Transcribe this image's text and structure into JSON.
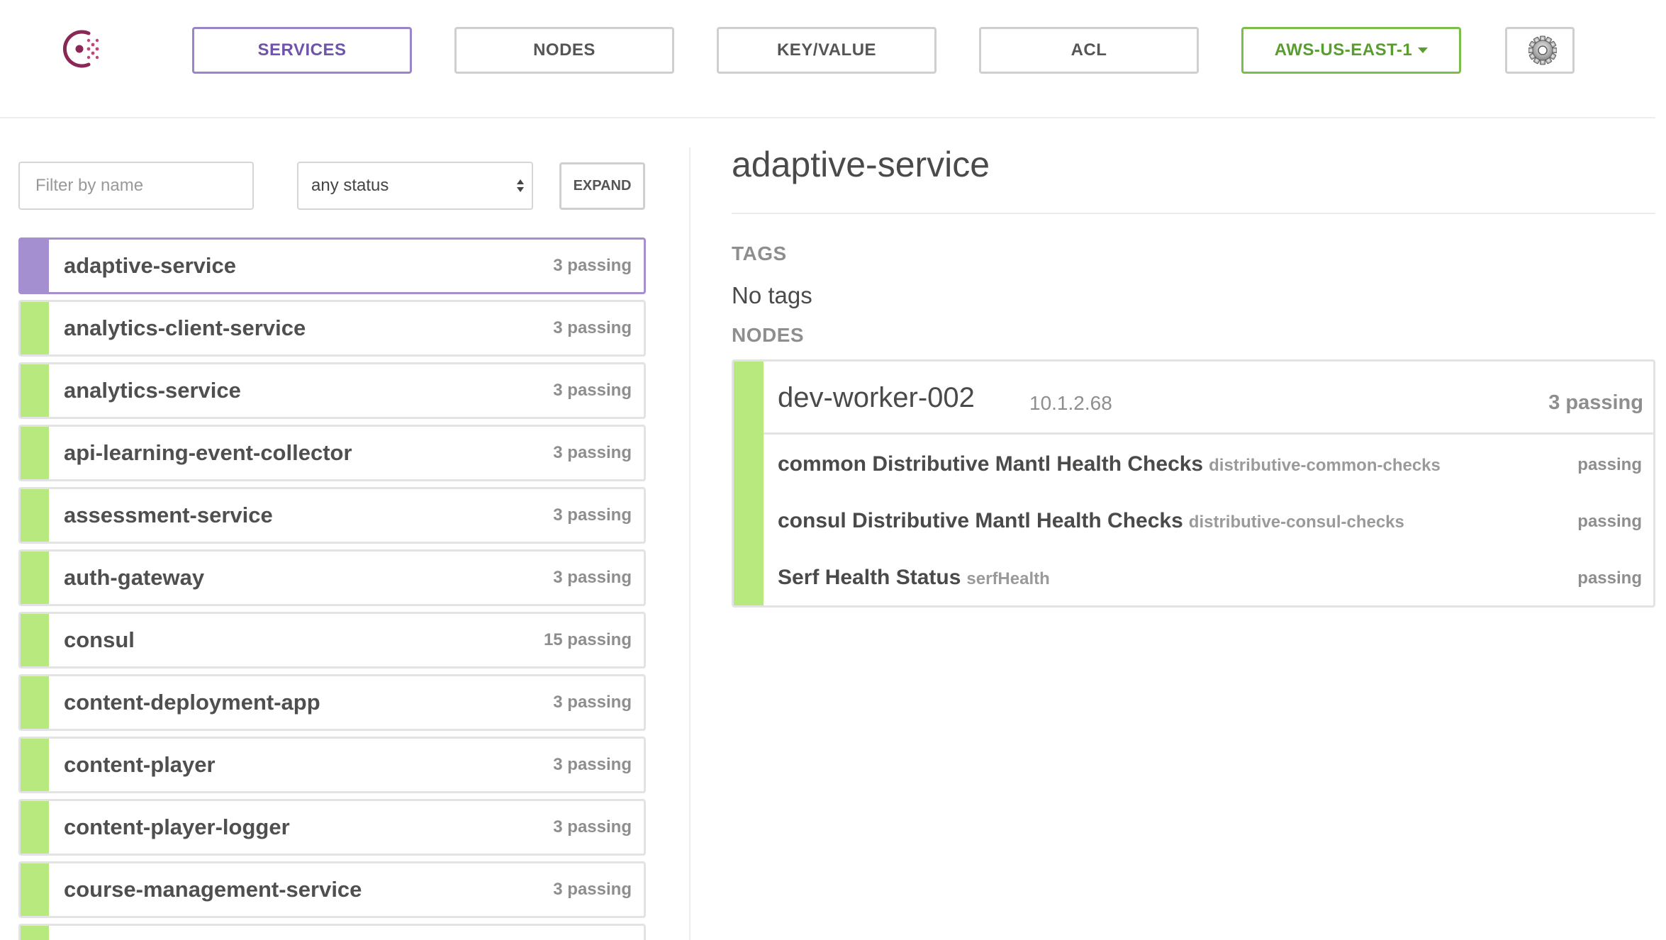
{
  "nav": {
    "services": "SERVICES",
    "nodes": "NODES",
    "key_value": "KEY/VALUE",
    "acl": "ACL",
    "datacenter": "AWS-US-EAST-1",
    "settings_icon": "gear-icon",
    "logo_icon": "consul-logo-icon"
  },
  "colors": {
    "accent": "#9a85c9",
    "passing": "#b7e97f",
    "datacenter": "#7cbd4b"
  },
  "filter": {
    "placeholder": "Filter by name",
    "status": "any status",
    "expand": "EXPAND"
  },
  "services": [
    {
      "name": "adaptive-service",
      "count": "3 passing",
      "active": true
    },
    {
      "name": "analytics-client-service",
      "count": "3 passing"
    },
    {
      "name": "analytics-service",
      "count": "3 passing"
    },
    {
      "name": "api-learning-event-collector",
      "count": "3 passing"
    },
    {
      "name": "assessment-service",
      "count": "3 passing"
    },
    {
      "name": "auth-gateway",
      "count": "3 passing"
    },
    {
      "name": "consul",
      "count": "15 passing"
    },
    {
      "name": "content-deployment-app",
      "count": "3 passing"
    },
    {
      "name": "content-player",
      "count": "3 passing"
    },
    {
      "name": "content-player-logger",
      "count": "3 passing"
    },
    {
      "name": "course-management-service",
      "count": "3 passing"
    },
    {
      "name": "",
      "count": ""
    }
  ],
  "detail": {
    "title": "adaptive-service",
    "tags_label": "TAGS",
    "tags_value": "No tags",
    "nodes_label": "NODES",
    "node": {
      "name": "dev-worker-002",
      "address": "10.1.2.68",
      "count": "3 passing",
      "checks": [
        {
          "name": "common Distributive Mantl Health Checks",
          "id": "distributive-common-checks",
          "status": "passing"
        },
        {
          "name": "consul Distributive Mantl Health Checks",
          "id": "distributive-consul-checks",
          "status": "passing"
        },
        {
          "name": "Serf Health Status",
          "id": "serfHealth",
          "status": "passing"
        }
      ]
    }
  }
}
